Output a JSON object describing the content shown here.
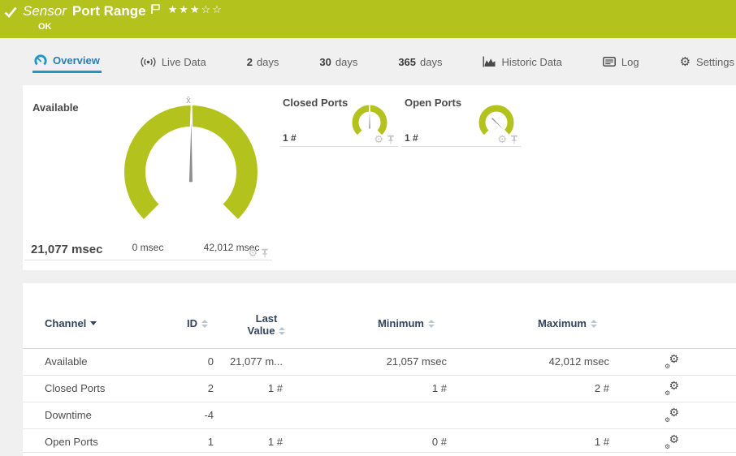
{
  "colors": {
    "status_green": "#b4c21e",
    "accent_blue": "#2196c9"
  },
  "header": {
    "kind_label": "Sensor",
    "name": "Port Range",
    "status": "OK",
    "rating": {
      "filled": 3,
      "total": 5
    }
  },
  "tabs": {
    "overview": {
      "label": "Overview",
      "active": true
    },
    "live_data": {
      "label": "Live Data"
    },
    "days2": {
      "num": "2",
      "label": "days"
    },
    "days30": {
      "num": "30",
      "label": "days"
    },
    "days365": {
      "num": "365",
      "label": "days"
    },
    "historic": {
      "label": "Historic Data"
    },
    "log": {
      "label": "Log"
    },
    "settings": {
      "label": "Settings"
    }
  },
  "gauges": {
    "available": {
      "title": "Available",
      "value": 21077,
      "min": 0,
      "max": 42012,
      "value_label": "21,077 msec",
      "min_label": "0 msec",
      "max_label": "42,012 msec",
      "mean_marker": "x̄"
    },
    "closed_ports": {
      "title": "Closed Ports",
      "value": 1,
      "min": 0,
      "max": 2,
      "value_label": "1 #"
    },
    "open_ports": {
      "title": "Open Ports",
      "value": 1,
      "min": 0,
      "max": 1,
      "value_label": "1 #"
    }
  },
  "table": {
    "headers": {
      "channel": "Channel",
      "id": "ID",
      "last_line1": "Last",
      "last_line2": "Value",
      "minimum": "Minimum",
      "maximum": "Maximum"
    },
    "rows": [
      {
        "channel": "Available",
        "id": "0",
        "last": "21,077 m...",
        "min": "21,057 msec",
        "max": "42,012 msec"
      },
      {
        "channel": "Closed Ports",
        "id": "2",
        "last": "1 #",
        "min": "1 #",
        "max": "2 #"
      },
      {
        "channel": "Downtime",
        "id": "-4",
        "last": "",
        "min": "",
        "max": ""
      },
      {
        "channel": "Open Ports",
        "id": "1",
        "last": "1 #",
        "min": "0 #",
        "max": "1 #"
      }
    ]
  }
}
